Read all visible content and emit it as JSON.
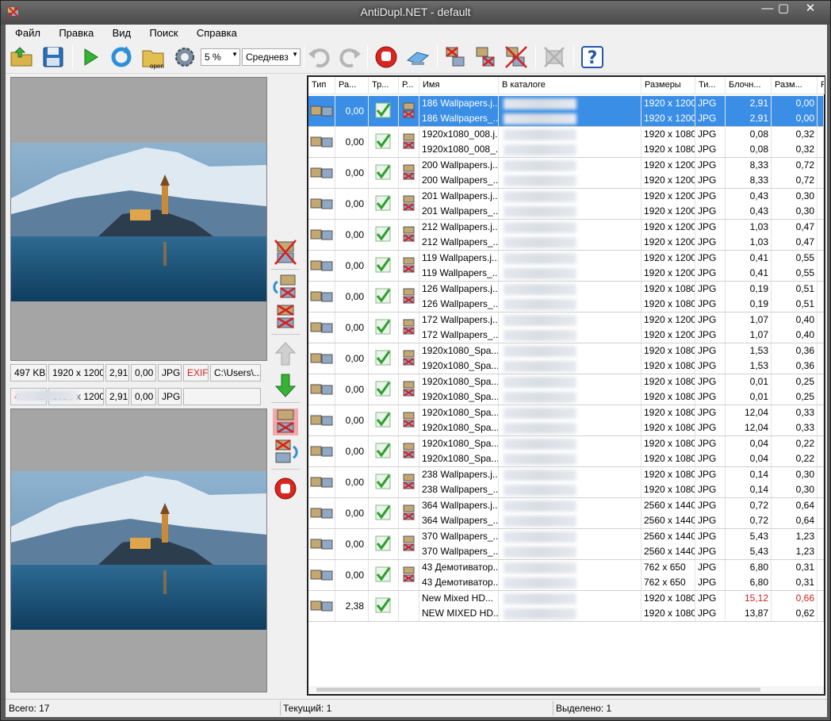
{
  "window": {
    "title": "AntiDupl.NET - default"
  },
  "menu": [
    "Файл",
    "Правка",
    "Вид",
    "Поиск",
    "Справка"
  ],
  "toolbar": {
    "threshold": "5 %",
    "mode": "Средневз",
    "open_label": "open"
  },
  "colors": {
    "selection": "#3a8ee6",
    "red": "#d32121",
    "sky": "#6f9bbd",
    "water": "#1c5277"
  },
  "top_info": {
    "size": "497 KB",
    "dims": "1920 x 1200",
    "blockiness": "2,91",
    "blur": "0,00",
    "type": "JPG",
    "exif": "EXIF",
    "path": "C:\\Users\\..."
  },
  "bottom_info": {
    "size": "497 KB",
    "dims": "1920 x 1200",
    "blockiness": "2,91",
    "blur": "0,00",
    "type": "JPG"
  },
  "columns": [
    "Тип",
    "Ра...",
    "Тр...",
    "Р...",
    "Имя",
    "В каталоге",
    "Размеры",
    "Ти...",
    "Блочн...",
    "Разм...",
    "Р"
  ],
  "rows": [
    {
      "diff": "0,00",
      "sel": true,
      "action": "delete",
      "a": {
        "name": "186 Wallpapers.j...",
        "dims": "1920 x 1200",
        "type": "JPG",
        "block": "2,91",
        "blur": "0,00"
      },
      "b": {
        "name": "186 Wallpapers_...",
        "dims": "1920 x 1200",
        "type": "JPG",
        "block": "2,91",
        "blur": "0,00"
      }
    },
    {
      "diff": "0,00",
      "action": "delete",
      "a": {
        "name": "1920x1080_008.j...",
        "dims": "1920 x 1080",
        "type": "JPG",
        "block": "0,08",
        "blur": "0,32"
      },
      "b": {
        "name": "1920x1080_008_...",
        "dims": "1920 x 1080",
        "type": "JPG",
        "block": "0,08",
        "blur": "0,32"
      }
    },
    {
      "diff": "0,00",
      "action": "delete",
      "a": {
        "name": "200 Wallpapers.j...",
        "dims": "1920 x 1200",
        "type": "JPG",
        "block": "8,33",
        "blur": "0,72"
      },
      "b": {
        "name": "200 Wallpapers_...",
        "dims": "1920 x 1200",
        "type": "JPG",
        "block": "8,33",
        "blur": "0,72"
      }
    },
    {
      "diff": "0,00",
      "action": "delete",
      "a": {
        "name": "201 Wallpapers.j...",
        "dims": "1920 x 1200",
        "type": "JPG",
        "block": "0,43",
        "blur": "0,30"
      },
      "b": {
        "name": "201 Wallpapers_...",
        "dims": "1920 x 1200",
        "type": "JPG",
        "block": "0,43",
        "blur": "0,30"
      }
    },
    {
      "diff": "0,00",
      "action": "delete",
      "a": {
        "name": "212 Wallpapers.j...",
        "dims": "1920 x 1200",
        "type": "JPG",
        "block": "1,03",
        "blur": "0,47"
      },
      "b": {
        "name": "212 Wallpapers_...",
        "dims": "1920 x 1200",
        "type": "JPG",
        "block": "1,03",
        "blur": "0,47"
      }
    },
    {
      "diff": "0,00",
      "action": "delete",
      "a": {
        "name": "119 Wallpapers.j...",
        "dims": "1920 x 1200",
        "type": "JPG",
        "block": "0,41",
        "blur": "0,55"
      },
      "b": {
        "name": "119 Wallpapers_...",
        "dims": "1920 x 1200",
        "type": "JPG",
        "block": "0,41",
        "blur": "0,55"
      }
    },
    {
      "diff": "0,00",
      "action": "delete",
      "a": {
        "name": "126 Wallpapers.j...",
        "dims": "1920 x 1080",
        "type": "JPG",
        "block": "0,19",
        "blur": "0,51"
      },
      "b": {
        "name": "126 Wallpapers_...",
        "dims": "1920 x 1080",
        "type": "JPG",
        "block": "0,19",
        "blur": "0,51"
      }
    },
    {
      "diff": "0,00",
      "action": "delete",
      "a": {
        "name": "172 Wallpapers.j...",
        "dims": "1920 x 1200",
        "type": "JPG",
        "block": "1,07",
        "blur": "0,40"
      },
      "b": {
        "name": "172 Wallpapers_...",
        "dims": "1920 x 1200",
        "type": "JPG",
        "block": "1,07",
        "blur": "0,40"
      }
    },
    {
      "diff": "0,00",
      "action": "delete",
      "a": {
        "name": "1920x1080_Spa...",
        "dims": "1920 x 1080",
        "type": "JPG",
        "block": "1,53",
        "blur": "0,36"
      },
      "b": {
        "name": "1920x1080_Spa...",
        "dims": "1920 x 1080",
        "type": "JPG",
        "block": "1,53",
        "blur": "0,36"
      }
    },
    {
      "diff": "0,00",
      "action": "delete",
      "a": {
        "name": "1920x1080_Spa...",
        "dims": "1920 x 1080",
        "type": "JPG",
        "block": "0,01",
        "blur": "0,25"
      },
      "b": {
        "name": "1920x1080_Spa...",
        "dims": "1920 x 1080",
        "type": "JPG",
        "block": "0,01",
        "blur": "0,25"
      }
    },
    {
      "diff": "0,00",
      "action": "delete",
      "a": {
        "name": "1920x1080_Spa...",
        "dims": "1920 x 1080",
        "type": "JPG",
        "block": "12,04",
        "blur": "0,33"
      },
      "b": {
        "name": "1920x1080_Spa...",
        "dims": "1920 x 1080",
        "type": "JPG",
        "block": "12,04",
        "blur": "0,33"
      }
    },
    {
      "diff": "0,00",
      "action": "delete",
      "a": {
        "name": "1920x1080_Spa...",
        "dims": "1920 x 1080",
        "type": "JPG",
        "block": "0,04",
        "blur": "0,22"
      },
      "b": {
        "name": "1920x1080_Spa...",
        "dims": "1920 x 1080",
        "type": "JPG",
        "block": "0,04",
        "blur": "0,22"
      }
    },
    {
      "diff": "0,00",
      "action": "delete",
      "a": {
        "name": "238 Wallpapers.j...",
        "dims": "1920 x 1080",
        "type": "JPG",
        "block": "0,14",
        "blur": "0,30"
      },
      "b": {
        "name": "238 Wallpapers_...",
        "dims": "1920 x 1080",
        "type": "JPG",
        "block": "0,14",
        "blur": "0,30"
      }
    },
    {
      "diff": "0,00",
      "action": "delete",
      "a": {
        "name": "364 Wallpapers.j...",
        "dims": "2560 x 1440",
        "type": "JPG",
        "block": "0,72",
        "blur": "0,64"
      },
      "b": {
        "name": "364 Wallpapers_...",
        "dims": "2560 x 1440",
        "type": "JPG",
        "block": "0,72",
        "blur": "0,64"
      }
    },
    {
      "diff": "0,00",
      "action": "delete",
      "a": {
        "name": "370 Wallpapers_...",
        "dims": "2560 x 1440",
        "type": "JPG",
        "block": "5,43",
        "blur": "1,23"
      },
      "b": {
        "name": "370 Wallpapers_...",
        "dims": "2560 x 1440",
        "type": "JPG",
        "block": "5,43",
        "blur": "1,23"
      }
    },
    {
      "diff": "0,00",
      "action": "delete",
      "a": {
        "name": "43  Демотиватор...",
        "dims": "762 x 650",
        "type": "JPG",
        "block": "6,80",
        "blur": "0,31"
      },
      "b": {
        "name": "43  Демотиватор...",
        "dims": "762 x 650",
        "type": "JPG",
        "block": "6,80",
        "blur": "0,31"
      }
    },
    {
      "diff": "2,38",
      "action": "none",
      "a": {
        "name": "New Mixed HD...",
        "dims": "1920 x 1080",
        "type": "JPG",
        "block": "15,12",
        "blur": "0,66",
        "red": true
      },
      "b": {
        "name": "NEW MIXED HD...",
        "dims": "1920 x 1080",
        "type": "JPG",
        "block": "13,87",
        "blur": "0,62"
      }
    }
  ],
  "status": {
    "total": "Всего: 17",
    "current": "Текущий: 1",
    "selected": "Выделено: 1"
  }
}
